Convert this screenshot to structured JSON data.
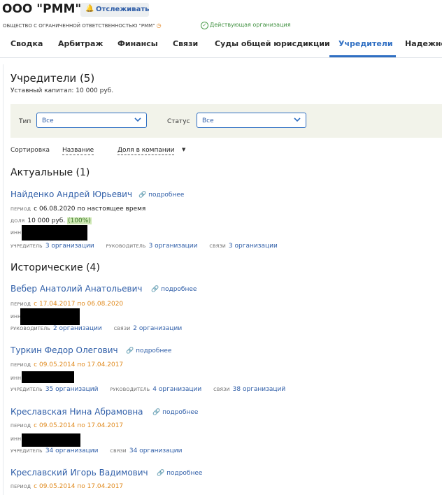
{
  "header": {
    "company": "ООО \"РММ\"",
    "follow_label": "Отслеживать",
    "full_name": "ОБЩЕСТВО С ОГРАНИЧЕННОЙ ОТВЕТСТВЕННОСТЬЮ \"РММ\"",
    "status": "Действующая организация"
  },
  "tabs": [
    "Сводка",
    "Арбитраж",
    "Финансы",
    "Связи",
    "Суды общей юрисдикции",
    "Учредители",
    "Надежно"
  ],
  "page": {
    "title": "Учредители (5)",
    "capital": "Уставный капитал: 10 000 руб."
  },
  "filters": {
    "type_label": "Тип",
    "type_value": "Все",
    "status_label": "Статус",
    "status_value": "Все"
  },
  "sort": {
    "label": "Сортировка",
    "by_name": "Название",
    "by_share": "Доля в компании"
  },
  "labels": {
    "more": "подробнее",
    "period": "ПЕРИОД",
    "share": "ДОЛЯ",
    "inn": "ИНН",
    "founder": "УЧРЕДИТЕЛЬ",
    "head": "РУКОВОДИТЕЛЬ",
    "links": "СВЯЗИ"
  },
  "current": {
    "title": "Актуальные (1)",
    "person": {
      "name": "Найденко Андрей Юрьевич",
      "period": "с 06.08.2020 по настоящее время",
      "share_value": "10 000 руб.",
      "share_percent": "(100%)",
      "founder": "3 организации",
      "head": "3 организации",
      "links": "3 организации"
    }
  },
  "historic": {
    "title": "Исторические (4)",
    "persons": [
      {
        "name": "Вебер Анатолий Анатольевич",
        "period": "с 17.04.2017 по 06.08.2020",
        "head": "2 организации",
        "links": "2 организации"
      },
      {
        "name": "Туркин Федор Олегович",
        "period": "с 09.05.2014 по 17.04.2017",
        "founder": "35 организаций",
        "head": "4 организации",
        "links": "38 организаций"
      },
      {
        "name": "Креславская Нина Абрамовна",
        "period": "с 09.05.2014 по 17.04.2017",
        "founder": "34 организации",
        "links": "34 организации"
      },
      {
        "name": "Креславский Игорь Вадимович",
        "period": "с 09.05.2014 по 17.04.2017"
      }
    ]
  }
}
